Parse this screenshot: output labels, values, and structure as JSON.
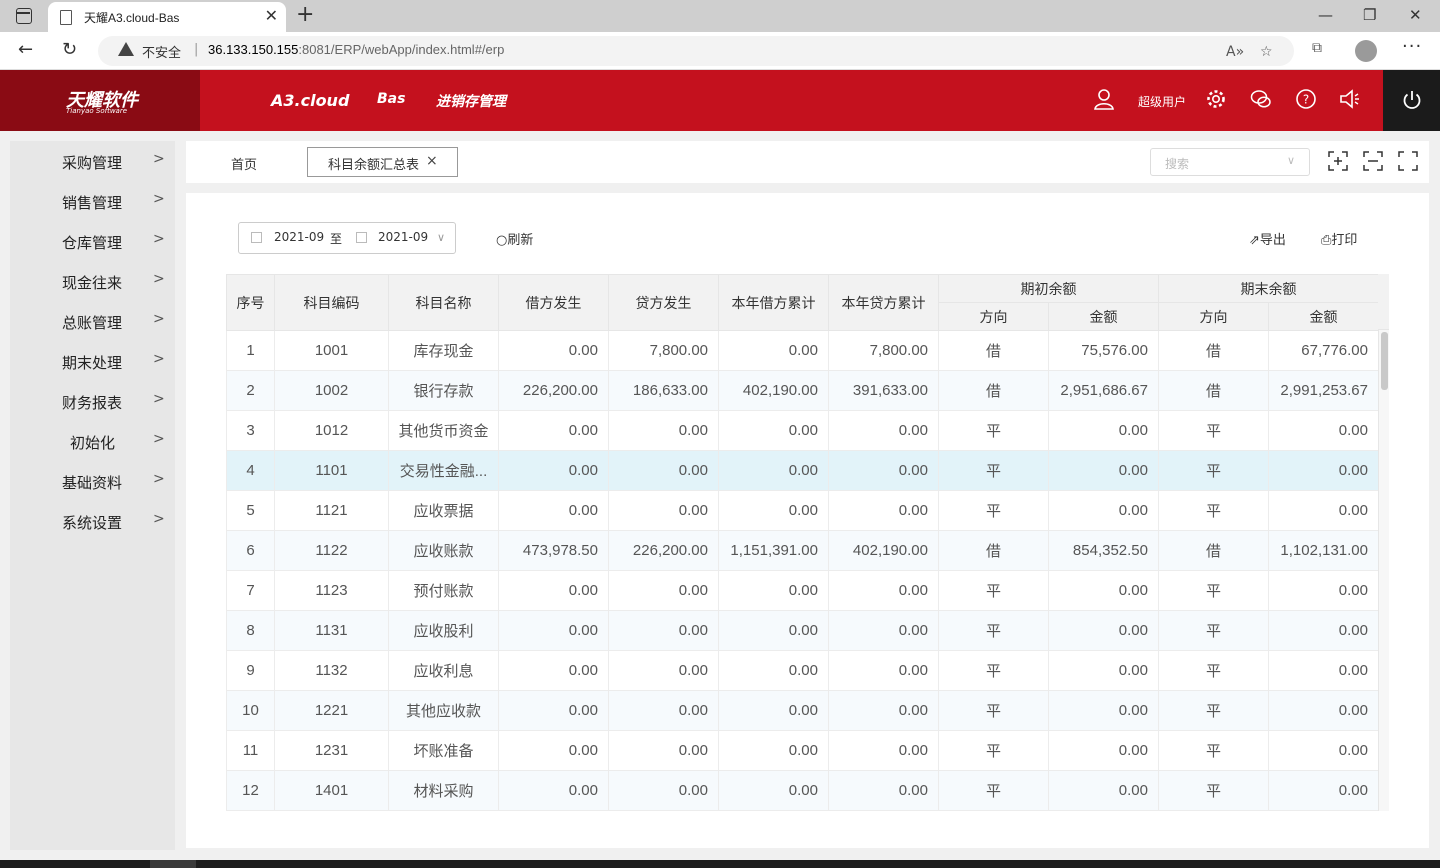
{
  "browser": {
    "tab_title": "天耀A3.cloud-Bas",
    "security_label": "不安全",
    "url_host": "36.133.150.155",
    "url_rest": ":8081/ERP/webApp/index.html#/erp"
  },
  "header": {
    "logo_main": "天耀软件",
    "logo_sub": "Tianyao Software",
    "nav": [
      "A3.cloud",
      "Bas",
      "进销存管理"
    ],
    "user_name": "超级用户"
  },
  "sidebar": {
    "items": [
      {
        "label": "采购管理"
      },
      {
        "label": "销售管理"
      },
      {
        "label": "仓库管理"
      },
      {
        "label": "现金往来"
      },
      {
        "label": "总账管理"
      },
      {
        "label": "期末处理"
      },
      {
        "label": "财务报表"
      },
      {
        "label": "初始化"
      },
      {
        "label": "基础资料"
      },
      {
        "label": "系统设置"
      }
    ]
  },
  "tabs": {
    "home": "首页",
    "active": "科目余额汇总表",
    "search_placeholder": "搜索"
  },
  "toolbar": {
    "date_from": "2021-09",
    "date_sep": "至",
    "date_to": "2021-09",
    "refresh": "刷新",
    "export": "导出",
    "print": "打印"
  },
  "table": {
    "headers": {
      "seq": "序号",
      "code": "科目编码",
      "name": "科目名称",
      "debit": "借方发生",
      "credit": "贷方发生",
      "ytd_debit": "本年借方累计",
      "ytd_credit": "本年贷方累计",
      "opening": "期初余额",
      "closing": "期末余额",
      "direction": "方向",
      "amount": "金额"
    },
    "rows": [
      [
        "1",
        "1001",
        "库存现金",
        "0.00",
        "7,800.00",
        "0.00",
        "7,800.00",
        "借",
        "75,576.00",
        "借",
        "67,776.00"
      ],
      [
        "2",
        "1002",
        "银行存款",
        "226,200.00",
        "186,633.00",
        "402,190.00",
        "391,633.00",
        "借",
        "2,951,686.67",
        "借",
        "2,991,253.67"
      ],
      [
        "3",
        "1012",
        "其他货币资金",
        "0.00",
        "0.00",
        "0.00",
        "0.00",
        "平",
        "0.00",
        "平",
        "0.00"
      ],
      [
        "4",
        "1101",
        "交易性金融...",
        "0.00",
        "0.00",
        "0.00",
        "0.00",
        "平",
        "0.00",
        "平",
        "0.00"
      ],
      [
        "5",
        "1121",
        "应收票据",
        "0.00",
        "0.00",
        "0.00",
        "0.00",
        "平",
        "0.00",
        "平",
        "0.00"
      ],
      [
        "6",
        "1122",
        "应收账款",
        "473,978.50",
        "226,200.00",
        "1,151,391.00",
        "402,190.00",
        "借",
        "854,352.50",
        "借",
        "1,102,131.00"
      ],
      [
        "7",
        "1123",
        "预付账款",
        "0.00",
        "0.00",
        "0.00",
        "0.00",
        "平",
        "0.00",
        "平",
        "0.00"
      ],
      [
        "8",
        "1131",
        "应收股利",
        "0.00",
        "0.00",
        "0.00",
        "0.00",
        "平",
        "0.00",
        "平",
        "0.00"
      ],
      [
        "9",
        "1132",
        "应收利息",
        "0.00",
        "0.00",
        "0.00",
        "0.00",
        "平",
        "0.00",
        "平",
        "0.00"
      ],
      [
        "10",
        "1221",
        "其他应收款",
        "0.00",
        "0.00",
        "0.00",
        "0.00",
        "平",
        "0.00",
        "平",
        "0.00"
      ],
      [
        "11",
        "1231",
        "坏账准备",
        "0.00",
        "0.00",
        "0.00",
        "0.00",
        "平",
        "0.00",
        "平",
        "0.00"
      ],
      [
        "12",
        "1401",
        "材料采购",
        "0.00",
        "0.00",
        "0.00",
        "0.00",
        "平",
        "0.00",
        "平",
        "0.00"
      ]
    ],
    "selected_row": 3
  },
  "colors": {
    "brand_red": "#c4111e",
    "brand_dark_red": "#8a0b14",
    "selected_row": "#e2f3f9"
  }
}
